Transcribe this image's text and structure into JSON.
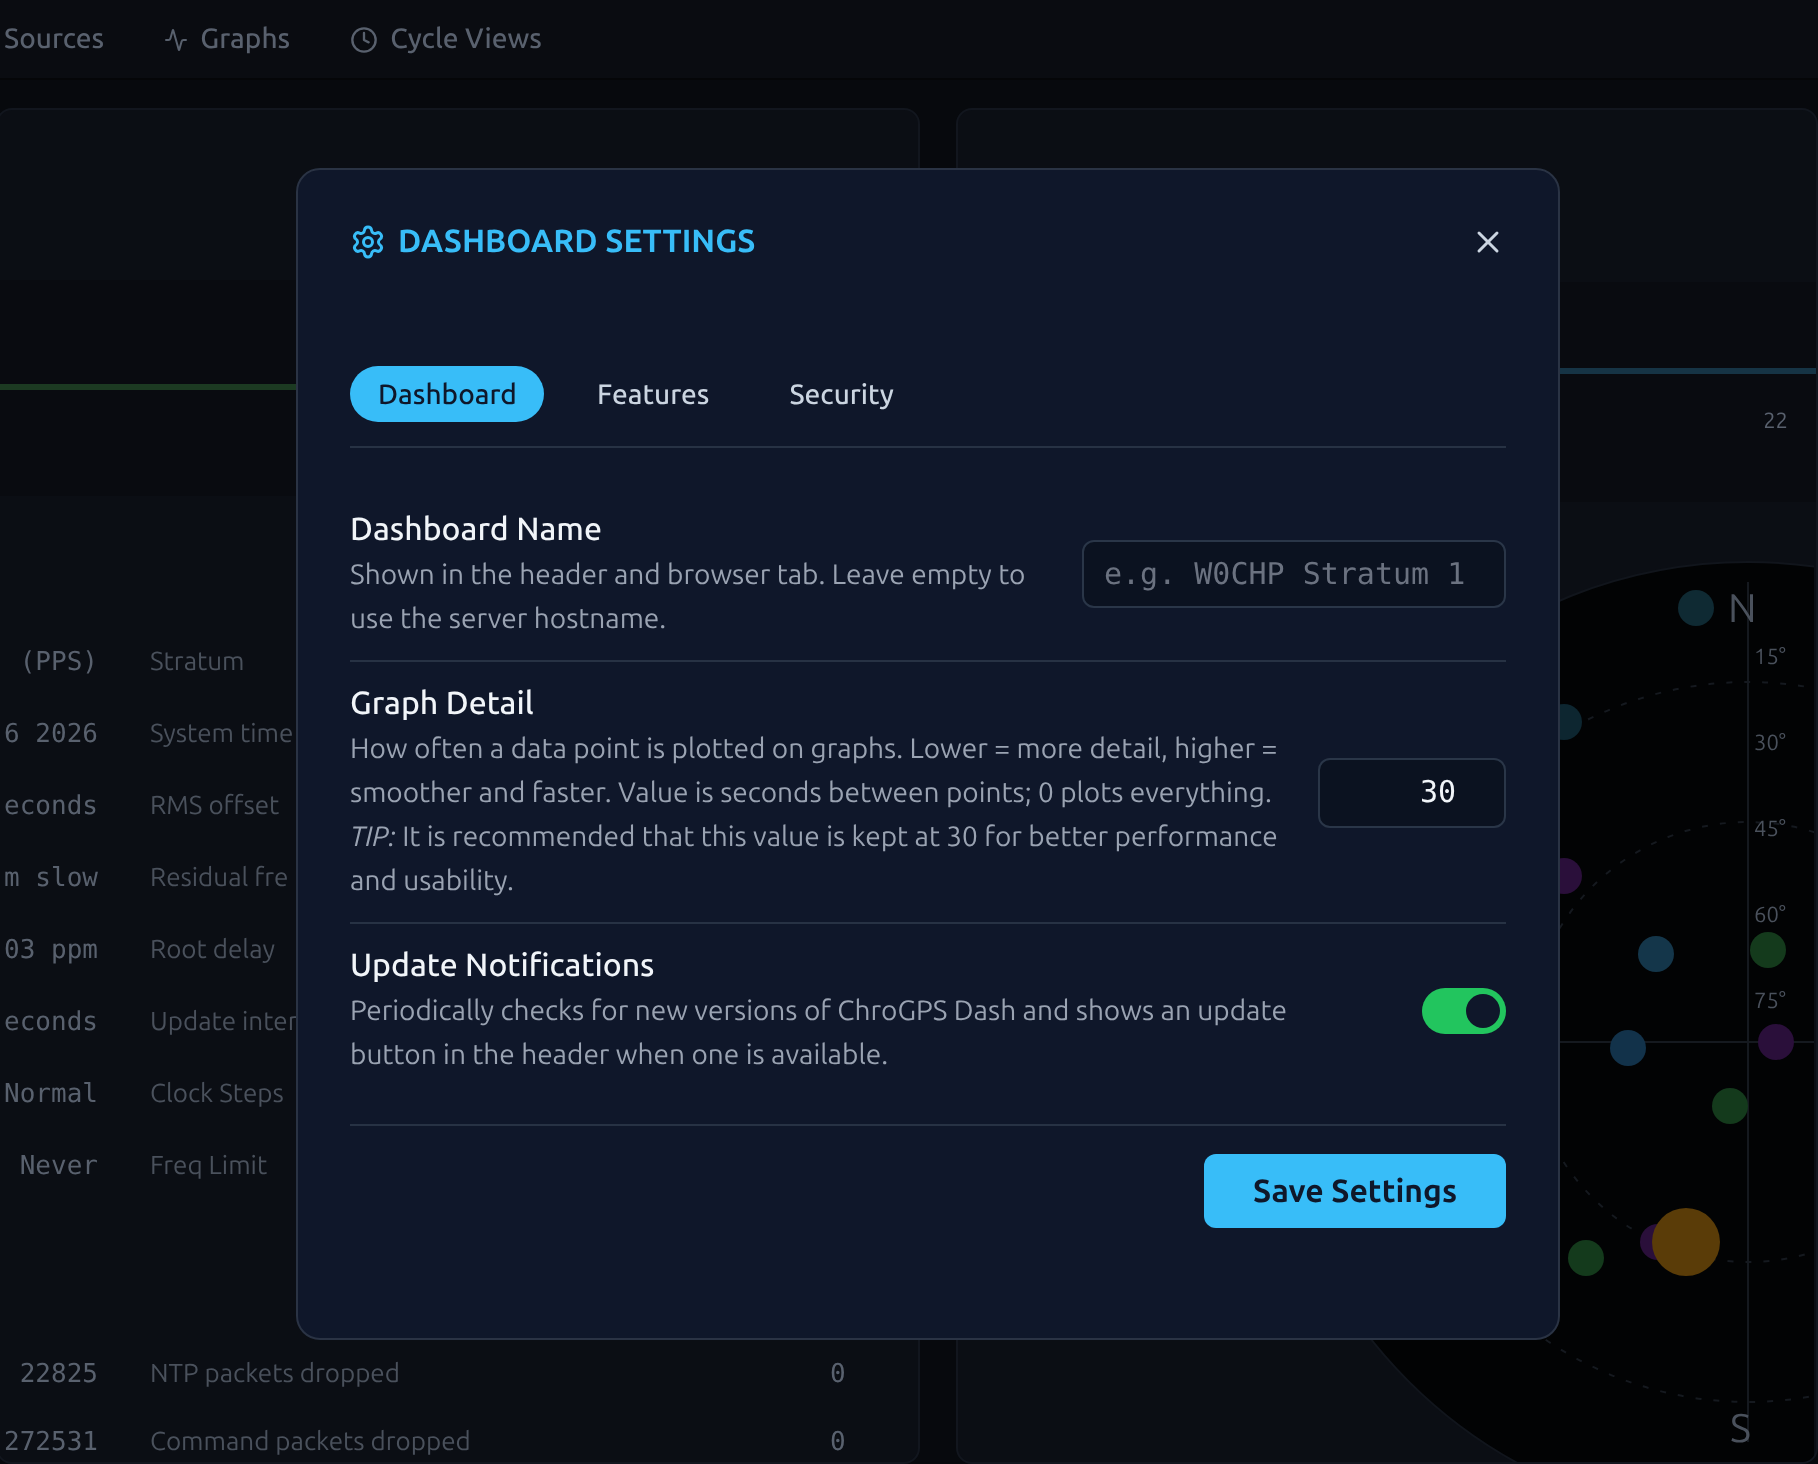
{
  "background": {
    "nav": [
      {
        "label": "Sources"
      },
      {
        "label": "Graphs"
      },
      {
        "label": "Cycle Views"
      }
    ],
    "stats": [
      {
        "value": "(PPS)",
        "label": "Stratum"
      },
      {
        "value": "6 2026",
        "label": "System time"
      },
      {
        "value": "econds",
        "label": "RMS offset"
      },
      {
        "value": "m slow",
        "label": "Residual fre"
      },
      {
        "value": "03 ppm",
        "label": "Root delay"
      },
      {
        "value": "econds",
        "label": "Update inter"
      },
      {
        "value": "Normal",
        "label": "Clock Steps"
      },
      {
        "value": "Never",
        "label": "Freq Limit"
      }
    ],
    "counters": [
      {
        "value": "22825",
        "label": "NTP packets dropped",
        "count": "0"
      },
      {
        "value": "272531",
        "label": "Command packets dropped",
        "count": "0"
      }
    ],
    "corner_label": "22",
    "sky_plot": {
      "north": "N",
      "south": "S",
      "elevations": [
        "15°",
        "30°",
        "45°",
        "60°",
        "75°"
      ]
    }
  },
  "modal": {
    "title": "DASHBOARD SETTINGS",
    "tabs": [
      {
        "label": "Dashboard",
        "selected": true
      },
      {
        "label": "Features",
        "selected": false
      },
      {
        "label": "Security",
        "selected": false
      }
    ],
    "settings": [
      {
        "kind": "text",
        "title": "Dashboard Name",
        "description": "Shown in the header and browser tab. Leave empty to use the server hostname.",
        "placeholder": "e.g. W0CHP Stratum 1"
      },
      {
        "kind": "number",
        "title": "Graph Detail",
        "description": "How often a data point is plotted on graphs. Lower = more detail, higher = smoother and faster. Value is seconds between points; 0 plots everything.",
        "note": "*TIP:* It is recommended that this value is kept at 30 for better performance and usability.",
        "value": "30"
      },
      {
        "kind": "toggle",
        "title": "Update Notifications",
        "description": "Periodically checks for new versions of ChroGPS Dash and shows an update button in the header when one is available.",
        "on": true
      }
    ],
    "save_button": "Save Settings"
  }
}
